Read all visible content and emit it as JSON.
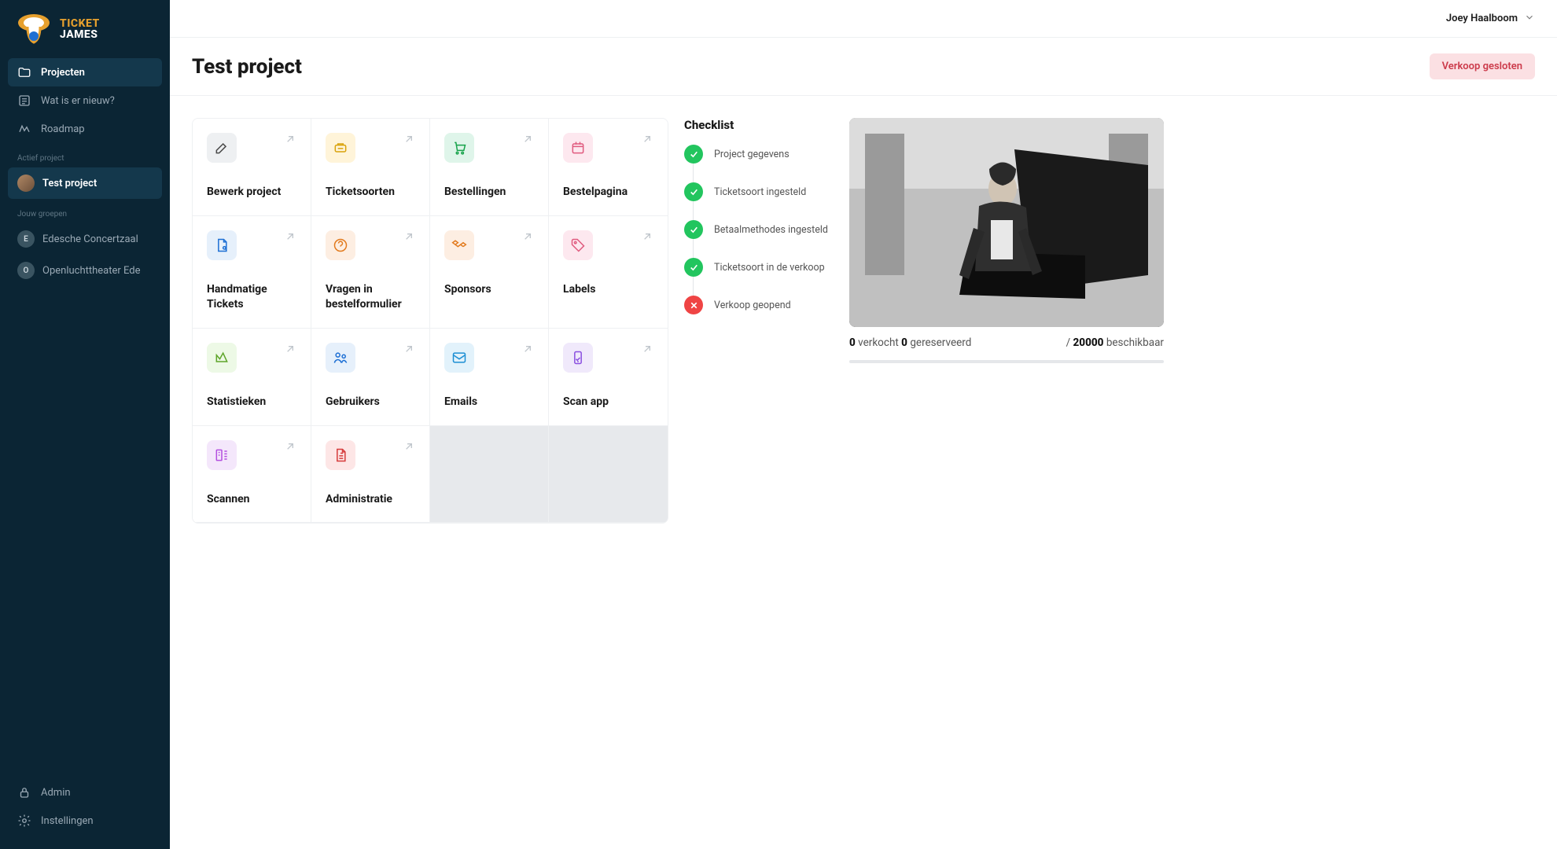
{
  "brand": {
    "line1": "TICKET",
    "line2": "JAMES"
  },
  "nav": {
    "items": [
      {
        "label": "Projecten"
      },
      {
        "label": "Wat is er nieuw?"
      },
      {
        "label": "Roadmap"
      }
    ],
    "active_section_label": "Actief project",
    "active_project": "Test project",
    "groups_label": "Jouw groepen",
    "groups": [
      {
        "initial": "E",
        "label": "Edesche Concertzaal"
      },
      {
        "initial": "O",
        "label": "Openluchttheater Ede"
      }
    ],
    "footer": [
      {
        "label": "Admin"
      },
      {
        "label": "Instellingen"
      }
    ]
  },
  "header": {
    "user": "Joey Haalboom",
    "title": "Test project",
    "status_label": "Verkoop gesloten"
  },
  "cards": [
    {
      "label": "Bewerk project",
      "icon_bg": "#eef0f2",
      "icon_stroke": "#4a4a4a"
    },
    {
      "label": "Ticketsoorten",
      "icon_bg": "#fff4d9",
      "icon_stroke": "#d9a20a"
    },
    {
      "label": "Bestellingen",
      "icon_bg": "#dff5ea",
      "icon_stroke": "#16a34a"
    },
    {
      "label": "Bestelpagina",
      "icon_bg": "#fde8ef",
      "icon_stroke": "#e05b7f"
    },
    {
      "label": "Handmatige Tickets",
      "icon_bg": "#e6f0fb",
      "icon_stroke": "#1d6fd4"
    },
    {
      "label": "Vragen in bestelformulier",
      "icon_bg": "#fdeee2",
      "icon_stroke": "#e27a1d"
    },
    {
      "label": "Sponsors",
      "icon_bg": "#fdeee2",
      "icon_stroke": "#e27a1d"
    },
    {
      "label": "Labels",
      "icon_bg": "#fde8ef",
      "icon_stroke": "#e05b7f"
    },
    {
      "label": "Statistieken",
      "icon_bg": "#edf9e6",
      "icon_stroke": "#5ea52a"
    },
    {
      "label": "Gebruikers",
      "icon_bg": "#e6f0fb",
      "icon_stroke": "#1d6fd4"
    },
    {
      "label": "Emails",
      "icon_bg": "#e2f2fb",
      "icon_stroke": "#1d8fd4"
    },
    {
      "label": "Scan app",
      "icon_bg": "#f0e9fb",
      "icon_stroke": "#8a4fe0"
    },
    {
      "label": "Scannen",
      "icon_bg": "#f4e7fb",
      "icon_stroke": "#b34fe0"
    },
    {
      "label": "Administratie",
      "icon_bg": "#fde6e6",
      "icon_stroke": "#d63a3a"
    }
  ],
  "checklist": {
    "title": "Checklist",
    "items": [
      {
        "label": "Project gegevens",
        "done": true
      },
      {
        "label": "Ticketsoort ingesteld",
        "done": true
      },
      {
        "label": "Betaalmethodes ingesteld",
        "done": true
      },
      {
        "label": "Ticketsoort in de verkoop",
        "done": true
      },
      {
        "label": "Verkoop geopend",
        "done": false
      }
    ]
  },
  "stats": {
    "sold": "0",
    "sold_label": "verkocht",
    "reserved": "0",
    "reserved_label": "gereserveerd",
    "available": "20000",
    "available_label": "beschikbaar",
    "divider": "/"
  }
}
